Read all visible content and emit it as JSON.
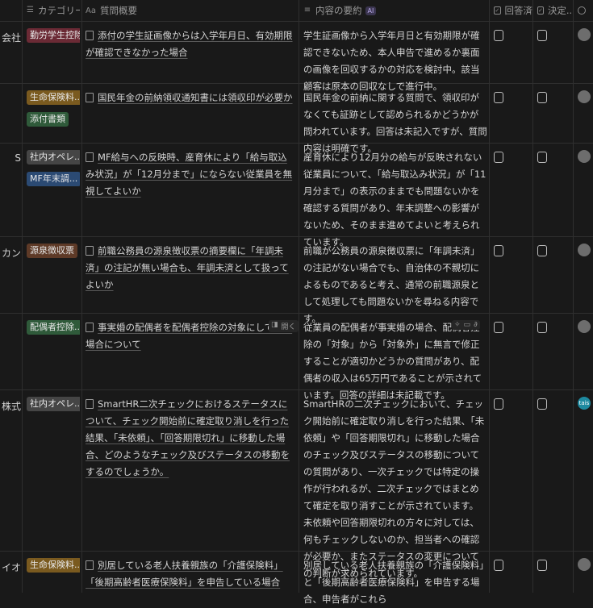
{
  "headers": {
    "category": "カテゴリー",
    "category_icon": "list-icon",
    "question": "質問概要",
    "question_prefix": "Aa",
    "summary": "内容の要約",
    "summary_badge": "AI",
    "answered": "回答済",
    "decided": "決定...",
    "person_icon": "person-icon"
  },
  "rows": [
    {
      "company": "会社",
      "tags": [
        {
          "label": "勤労学生控除",
          "color": "red"
        }
      ],
      "question": "添付の学生証画像からは入学年月日、有効期限が確認できなかった場合",
      "summary": "学生証画像から入学年月日と有効期限が確認できないため、本人申告で進めるか裏面の画像を回収するかの対応を検討中。該当顧客は原本の回収なしで進行中。"
    },
    {
      "company": "",
      "tags": [
        {
          "label": "生命保険料...",
          "color": "orange"
        },
        {
          "label": "添付書類",
          "color": "green"
        }
      ],
      "question": "国民年金の前納領収通知書には領収印が必要か",
      "summary": "国民年金の前納に関する質問で、領収印がなくても証跡として認められるかどうかが問われています。回答は未記入ですが、質問内容は明確です。"
    },
    {
      "company": "S",
      "tags": [
        {
          "label": "社内オペレ...",
          "color": "gray"
        },
        {
          "label": "MF年末調...",
          "color": "blue"
        }
      ],
      "question": "MF給与への反映時、産育休により「給与取込み状況」が「12月分まで」にならない従業員を無視してよいか",
      "summary": "産育休により12月分の給与が反映されない従業員について、「給与取込み状況」が「11月分まで」の表示のままでも問題ないかを確認する質問があり、年末調整への影響がないため、そのまま進めてよいと考えられています。"
    },
    {
      "company": "カン",
      "tags": [
        {
          "label": "源泉徴収票",
          "color": "brown"
        }
      ],
      "question": "前職公務員の源泉徴収票の摘要欄に「年調未済」の注記が無い場合も、年調未済として扱ってよいか",
      "summary": "前職が公務員の源泉徴収票に「年調未済」の注記がない場合でも、自治体の不親切によるものであると考え、通常の前職源泉として処理しても問題ないかを尋ねる内容です。"
    },
    {
      "company": "",
      "tags": [
        {
          "label": "配偶者控除...",
          "color": "green"
        }
      ],
      "question": "事実婚の配偶者を配偶者控除の対象にしている場合について",
      "open_label": "開く",
      "summary": "従業員の配偶者が事実婚の場合、配偶者控除の「対象」から「対象外」に無言で修正することが適切かどうかの質問があり、配偶者の収入は65万円であることが示されています。回答の詳細は未記載です。"
    },
    {
      "company": "株式",
      "tags": [
        {
          "label": "社内オペレ...",
          "color": "gray"
        }
      ],
      "question": "SmartHR二次チェックにおけるステータスについて、チェック開始前に確定取り消しを行った結果、「未依頼」、「回答期限切れ」に移動した場合、どのようなチェック及びステータスの移動をするのでしょうか。",
      "summary": "SmartHRの二次チェックにおいて、チェック開始前に確定取り消しを行った結果、「未依頼」や「回答期限切れ」に移動した場合のチェック及びステータスの移動についての質問があり、一次チェックでは特定の操作が行われるが、二次チェックではまとめて確定を取り消すことが示されています。未依頼や回答期限切れの方々に対しては、何もチェックしないのか、担当者への確認が必要か、またステータスの変更についての判断が求められています。",
      "avatar_text": "tais"
    },
    {
      "company": "イオ",
      "tags": [
        {
          "label": "生命保険料...",
          "color": "orange"
        }
      ],
      "question": "別居している老人扶養親族の「介護保険料」「後期高齢者医療保険料」を申告している場合",
      "summary": "別居している老人扶養親族の「介護保険料」と「後期高齢者医療保険料」を申告する場合、申告者がこれら"
    }
  ]
}
